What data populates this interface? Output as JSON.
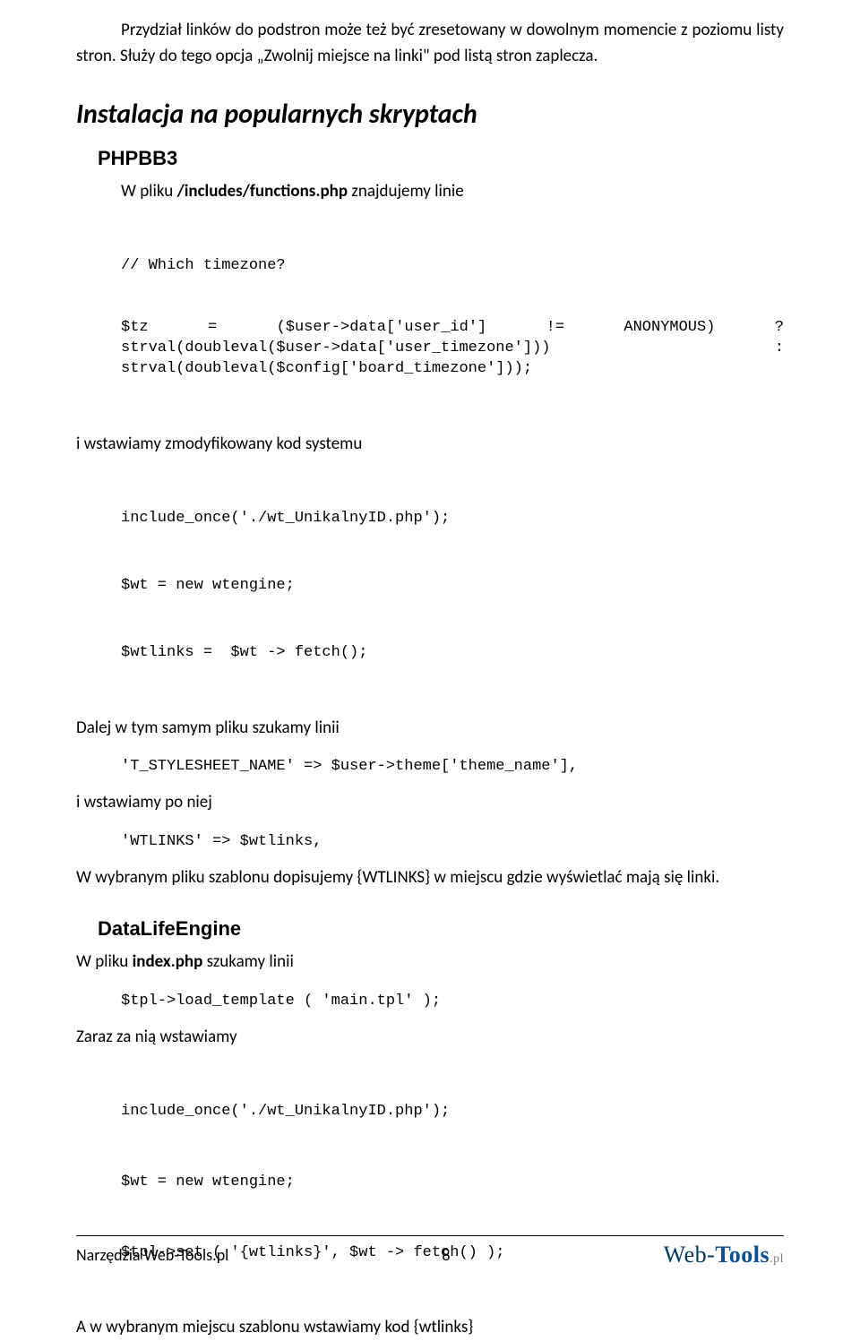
{
  "paragraphs": {
    "intro": "Przydział linków do podstron może też być zresetowany w dowolnym momencie z poziomu listy stron. Służy do tego opcja „Zwolnij miejsce na linki\" pod listą stron zaplecza."
  },
  "headings": {
    "h1": "Instalacja na popularnych skryptach",
    "h2_phpbb": "PHPBB3",
    "h2_dle": "DataLifeEngine"
  },
  "phpbb": {
    "file_intro_prefix": "W pliku ",
    "file_name": "/includes/functions.php",
    "file_intro_suffix": " znajdujemy linie",
    "code1_line1": "// Which timezone?",
    "code1_line2": "$tz   =   ($user->data['user_id']   !=   ANONYMOUS)   ?   strval(doubleval($user->data['user_timezone'])) : strval(doubleval($config['board_timezone']));",
    "after_code1": "i wstawiamy zmodyfikowany kod systemu",
    "code2_l1": "include_once('./wt_UnikalnyID.php');",
    "code2_l2": "$wt = new wtengine;",
    "code2_l3": "$wtlinks =  $wt -> fetch();",
    "after_code2": "Dalej w tym samym pliku szukamy linii",
    "code3": "'T_STYLESHEET_NAME' => $user->theme['theme_name'],",
    "after_code3": "i wstawiamy po niej",
    "code4": "'WTLINKS' => $wtlinks,",
    "after_code4": "W wybranym pliku szablonu dopisujemy {WTLINKS} w miejscu gdzie wyświetlać mają się linki."
  },
  "dle": {
    "file_intro_prefix": "W pliku ",
    "file_name": "index.php",
    "file_intro_suffix": " szukamy linii",
    "code1": "$tpl->load_template ( 'main.tpl' );",
    "after_code1": "Zaraz za nią wstawiamy",
    "code2_l1": "include_once('./wt_UnikalnyID.php');",
    "code2_l2": "$wt = new wtengine;",
    "code2_l3": "$tpl->set ( '{wtlinks}', $wt -> fetch() );",
    "after_code2": "A w wybranym miejscu szablonu wstawiamy kod {wtlinks}"
  },
  "footer": {
    "left": "Narzędzia Web-Tools.pl",
    "page_number": "8",
    "brand_web": "Web-",
    "brand_tools": "Tools",
    "brand_tld": ".pl"
  }
}
